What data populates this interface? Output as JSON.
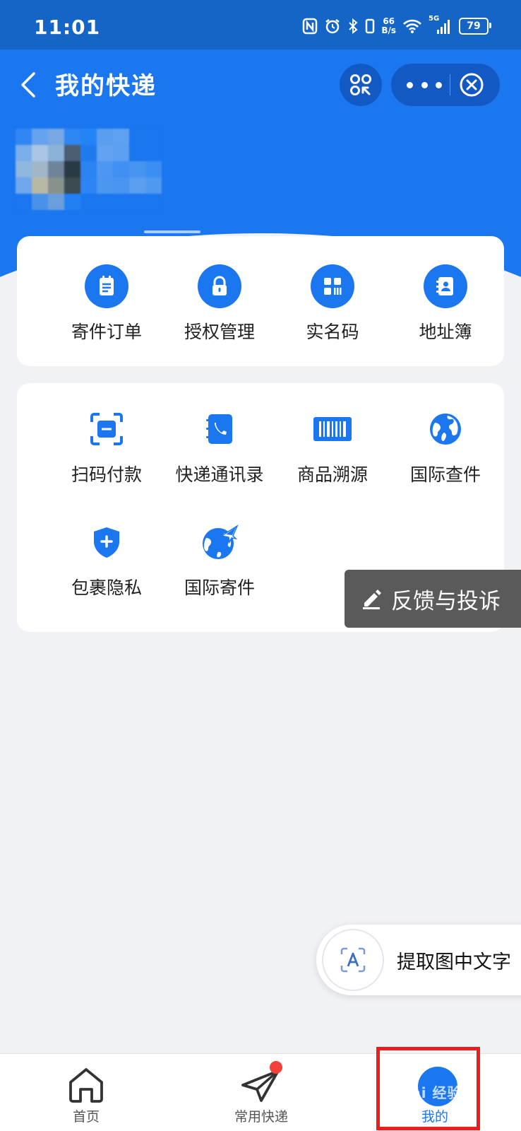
{
  "status_bar": {
    "time": "11:01",
    "net_speed_value": "66",
    "net_speed_unit": "B/s",
    "network": "5G",
    "battery": "79"
  },
  "header": {
    "title": "我的快递",
    "back_icon": "chevron-left-icon",
    "scan_icon": "mini-program-icon",
    "more_icon": "more-icon",
    "close_icon": "close-circle-icon",
    "color": "#1a77f0"
  },
  "main_actions": [
    {
      "label": "寄件订单",
      "icon": "order-list-icon"
    },
    {
      "label": "授权管理",
      "icon": "lock-icon"
    },
    {
      "label": "实名码",
      "icon": "grid-code-icon"
    },
    {
      "label": "地址簿",
      "icon": "contact-book-icon"
    }
  ],
  "services": [
    {
      "label": "扫码付款",
      "icon": "scan-pay-icon"
    },
    {
      "label": "快递通讯录",
      "icon": "phone-book-icon"
    },
    {
      "label": "商品溯源",
      "icon": "barcode-icon"
    },
    {
      "label": "国际查件",
      "icon": "globe-icon"
    },
    {
      "label": "包裹隐私",
      "icon": "shield-plus-icon"
    },
    {
      "label": "国际寄件",
      "icon": "globe-plane-icon"
    }
  ],
  "feedback": {
    "label": "反馈与投诉",
    "icon": "pencil-icon"
  },
  "ocr": {
    "label": "提取图中文字",
    "icon": "text-scan-icon"
  },
  "tab_bar": {
    "tabs": [
      {
        "label": "首页",
        "icon": "home-icon"
      },
      {
        "label": "常用快递",
        "icon": "paper-plane-icon",
        "badge": true
      },
      {
        "label": "我的",
        "icon": "avatar-icon",
        "active": true
      }
    ]
  },
  "watermark": "Bai 经验",
  "colors": {
    "accent": "#1a77f0",
    "highlight": "#ee1c1c",
    "badge": "#f0413b"
  }
}
